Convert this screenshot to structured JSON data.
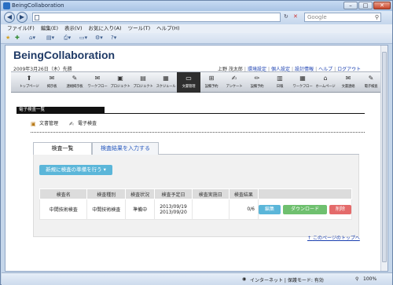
{
  "browser": {
    "title": "BeingCollaboration",
    "search_placeholder": "Google",
    "menu": [
      "ファイル(F)",
      "編集(E)",
      "表示(V)",
      "お気に入り(A)",
      "ツール(T)",
      "ヘルプ(H)"
    ],
    "status_zone": "インターネット | 保護モード: 有効",
    "zoom": "100%"
  },
  "app": {
    "brand": "BeingCollaboration",
    "date": "2009年3月26日（木）先勝",
    "user_links": {
      "user": "上野 茂太郎",
      "items": [
        "環境設定",
        "個人設定",
        "設計情報",
        "ヘルプ",
        "ログアウト"
      ]
    },
    "nav": [
      {
        "icon": "home-icon",
        "glyph": "⬆",
        "label": "トップページ"
      },
      {
        "icon": "bulletin-icon",
        "glyph": "✉",
        "label": "掲示板"
      },
      {
        "icon": "message-icon",
        "glyph": "✎",
        "label": "連絡掲示板"
      },
      {
        "icon": "mail-icon",
        "glyph": "✉",
        "label": "ワークフロー"
      },
      {
        "icon": "book-icon",
        "glyph": "▣",
        "label": "プロジェクト"
      },
      {
        "icon": "clipboard-icon",
        "glyph": "▤",
        "label": "プロジェクト"
      },
      {
        "icon": "schedule-icon",
        "glyph": "▦",
        "label": "スケジュール"
      },
      {
        "icon": "folder-icon",
        "glyph": "▭",
        "label": "文書管理",
        "active": true
      },
      {
        "icon": "equipment-icon",
        "glyph": "⊞",
        "label": "設備予約"
      },
      {
        "icon": "survey-icon",
        "glyph": "✍",
        "label": "アンケート"
      },
      {
        "icon": "pencil-icon",
        "glyph": "✏",
        "label": "設備予約"
      },
      {
        "icon": "log-icon",
        "glyph": "▥",
        "label": "日報"
      },
      {
        "icon": "workflow-icon",
        "glyph": "▦",
        "label": "ワークフロー"
      },
      {
        "icon": "homepage-icon",
        "glyph": "⌂",
        "label": "ホームページ"
      },
      {
        "icon": "document-icon",
        "glyph": "✉",
        "label": "文書連絡"
      },
      {
        "icon": "edit-icon",
        "glyph": "✎",
        "label": "電子検査"
      }
    ]
  },
  "section": {
    "title": "電子検査一覧",
    "subnav": [
      {
        "icon": "document-manage-icon",
        "glyph": "▣",
        "label": "文書管理"
      },
      {
        "icon": "inspection-icon",
        "glyph": "✍",
        "label": "電子検査"
      }
    ]
  },
  "tabs": [
    {
      "label": "検査一覧"
    },
    {
      "label": "検査結果を入力する"
    }
  ],
  "panel": {
    "new_button": "新規に検査の準備を行う ▾",
    "columns": [
      "検査名",
      "検査種別",
      "検査状況",
      "検査予定日",
      "検査実施日",
      "検査結果",
      ""
    ],
    "rows": [
      {
        "name": "中間技術検査",
        "type": "中間技術検査",
        "status": "準備中",
        "planned_1": "2013/09/19",
        "planned_2": "2013/09/20",
        "done": "",
        "result": "0/6",
        "actions": {
          "edit": "編集",
          "download": "ダウンロード",
          "delete": "削除"
        }
      }
    ],
    "top_link": "このページのトップへ"
  }
}
